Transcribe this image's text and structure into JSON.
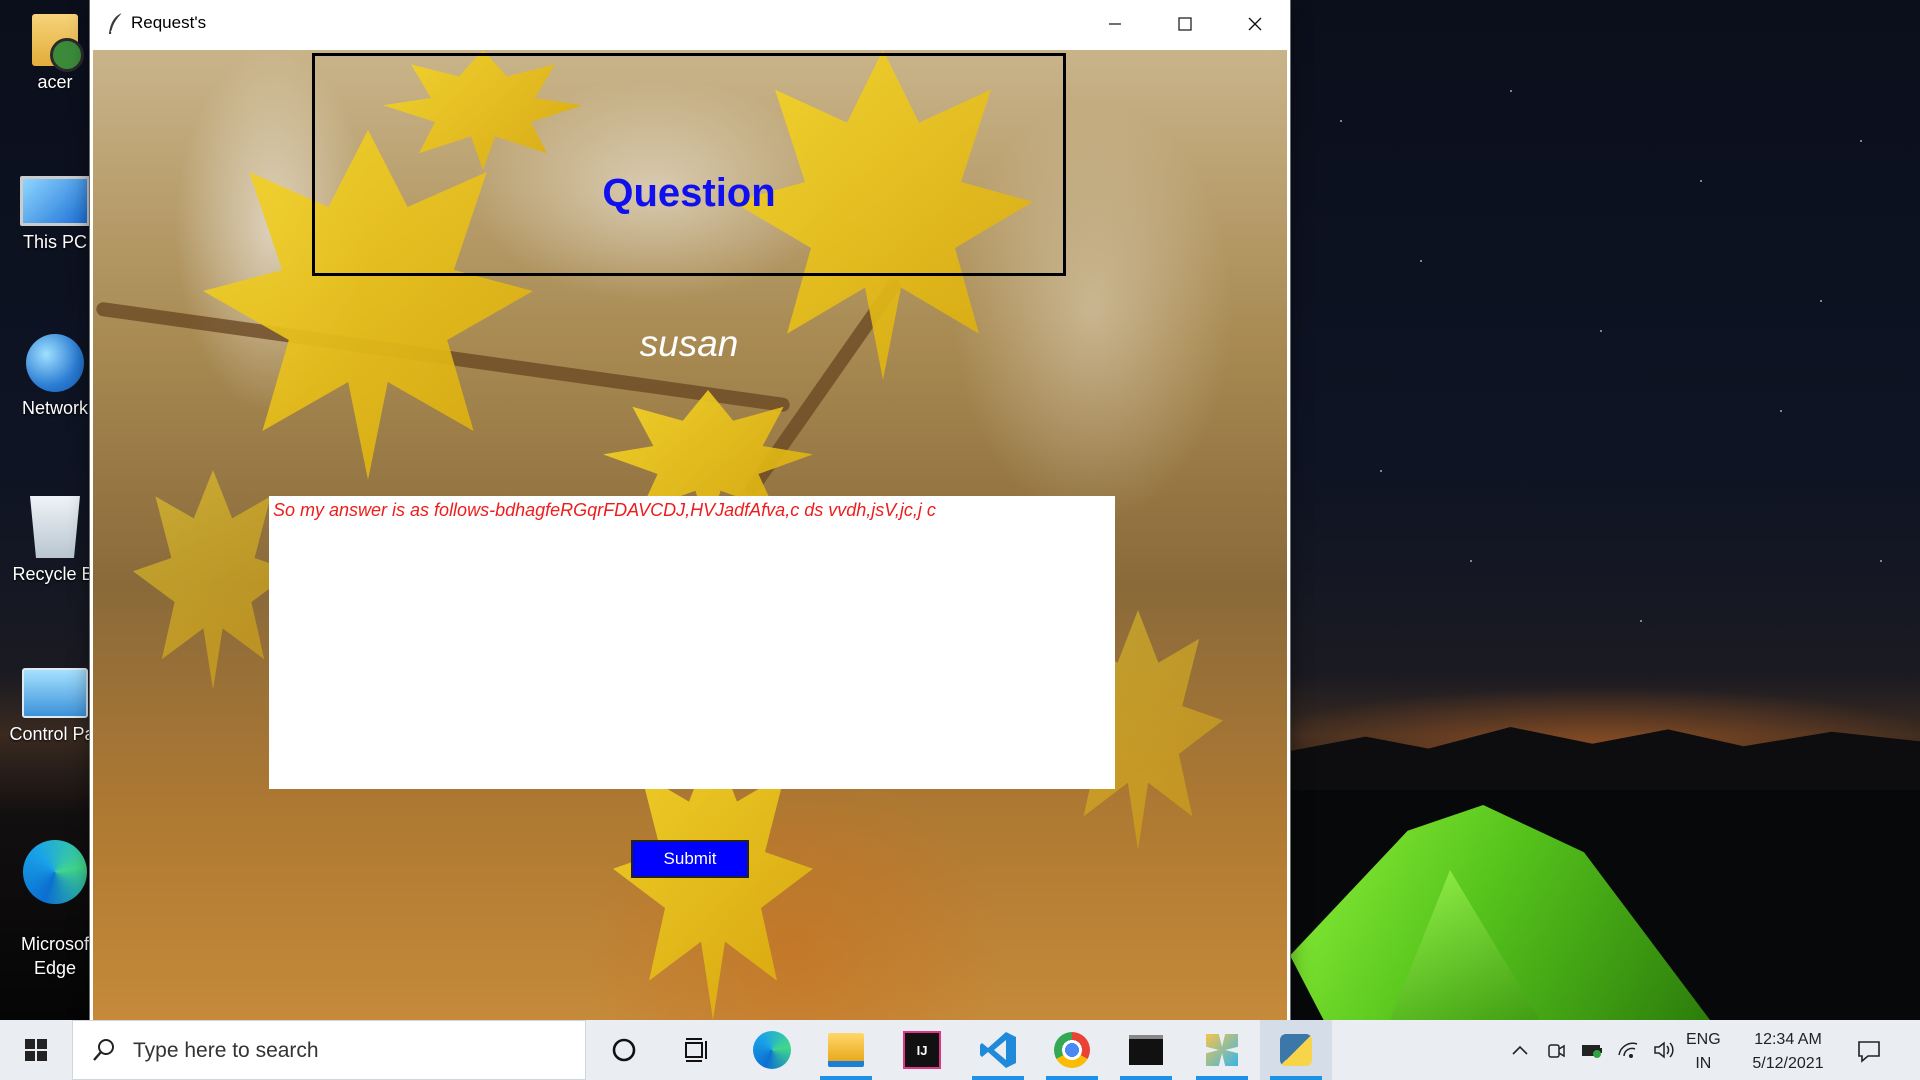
{
  "desktop": {
    "icons": [
      {
        "label": "acer",
        "icon": "user-folder-icon"
      },
      {
        "label": "This PC",
        "icon": "computer-icon"
      },
      {
        "label": "Network",
        "icon": "network-icon"
      },
      {
        "label": "Recycle Bi",
        "icon": "recycle-bin-icon"
      },
      {
        "label": "Control Par",
        "icon": "control-panel-icon"
      },
      {
        "label": "Microsof\nEdge",
        "icon": "edge-icon"
      }
    ]
  },
  "window": {
    "title": "Request's",
    "controls": {
      "minimize": "minimize-icon",
      "maximize": "maximize-icon",
      "close": "close-icon"
    }
  },
  "form": {
    "heading": "Question",
    "username": "susan",
    "answer_value": "So my answer is as follows-bdhagfeRGqrFDAVCDJ,HVJadfAfva,c ds vvdh,jsV,jc,j c",
    "submit_label": "Submit",
    "colors": {
      "heading": "#1010ee",
      "answer_text": "#ee1c1c",
      "submit_bg": "#0000ff"
    }
  },
  "taskbar": {
    "search_placeholder": "Type here to search",
    "apps": [
      "cortana-icon",
      "task-view-icon",
      "edge-icon",
      "file-explorer-icon",
      "intellij-icon",
      "vscode-icon",
      "chrome-icon",
      "terminal-icon",
      "snipping-tool-icon",
      "python-icon"
    ],
    "language": {
      "line1": "ENG",
      "line2": "IN"
    },
    "time": "12:34 AM",
    "date": "5/12/2021"
  }
}
